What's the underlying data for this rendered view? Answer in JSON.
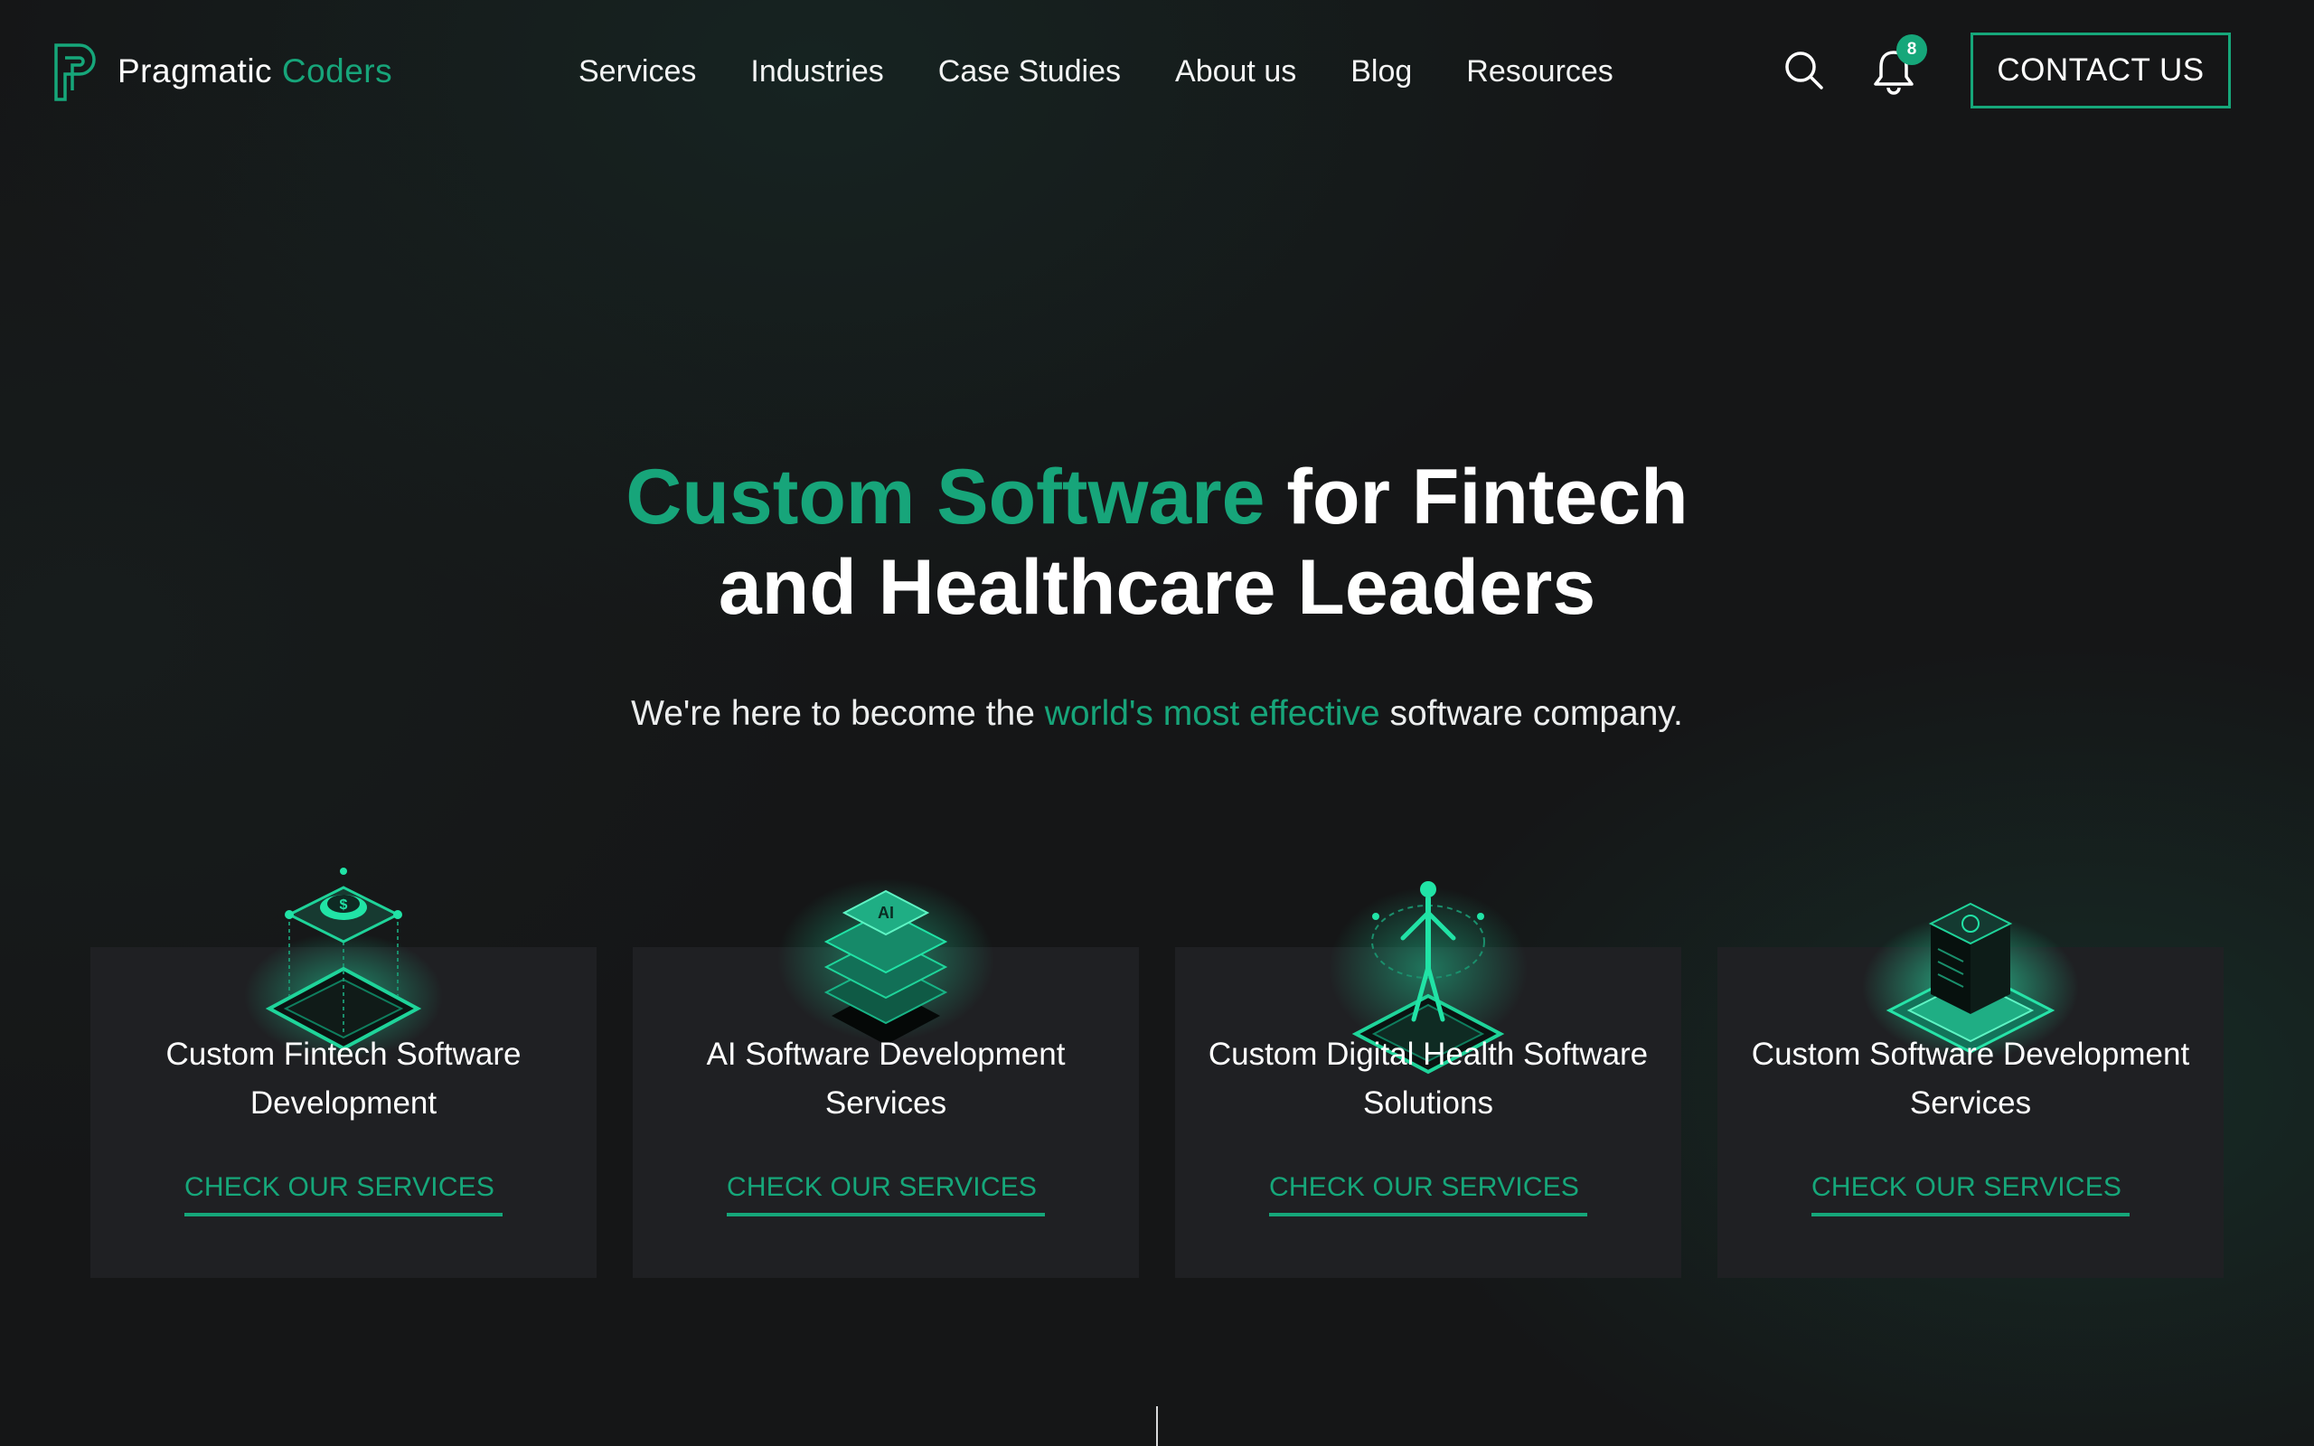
{
  "header": {
    "logo": {
      "word1": "Pragmatic",
      "word2": "Coders"
    },
    "nav": [
      "Services",
      "Industries",
      "Case Studies",
      "About us",
      "Blog",
      "Resources"
    ],
    "notification_count": "8",
    "contact_label": "CONTACT US",
    "icons": {
      "search": "search-icon",
      "bell": "bell-icon"
    }
  },
  "hero": {
    "title_accent": "Custom Software",
    "title_line1_rest": " for Fintech",
    "title_line2": "and Healthcare Leaders",
    "subtitle_pre": "We're here to become the ",
    "subtitle_accent": "world's most effective",
    "subtitle_post": " software company."
  },
  "cards": [
    {
      "title": "Custom Fintech Software Development",
      "link": "CHECK OUR SERVICES",
      "icon": "fintech-cube-icon"
    },
    {
      "title": "AI Software Development Services",
      "link": "CHECK OUR SERVICES",
      "icon": "ai-chip-stack-icon"
    },
    {
      "title": "Custom Digital Health Software Solutions",
      "link": "CHECK OUR SERVICES",
      "icon": "digital-health-hologram-icon"
    },
    {
      "title": "Custom Software Development Services",
      "link": "CHECK OUR SERVICES",
      "icon": "server-block-icon"
    }
  ],
  "colors": {
    "accent": "#16a77a",
    "background": "#151617",
    "card": "#1f2023"
  }
}
